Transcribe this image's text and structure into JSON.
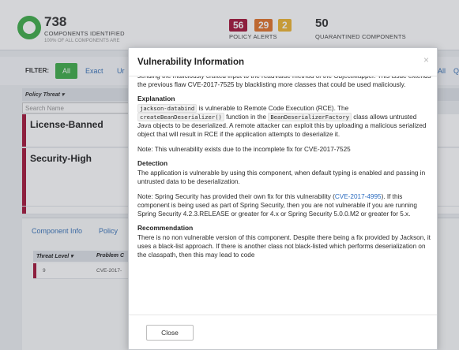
{
  "dashboard": {
    "components_count": "738",
    "components_label": "COMPONENTS IDENTIFIED",
    "components_sub": "100% OF ALL COMPONENTS ARE",
    "policy_alerts": {
      "red": "56",
      "orange": "29",
      "yellow": "2",
      "label": "POLICY ALERTS"
    },
    "quarantined_count": "50",
    "quarantined_label": "QUARANTINED COMPONENTS"
  },
  "filter": {
    "label": "FILTER:",
    "all": "All",
    "exact": "Exact",
    "partial": "Ur",
    "right_all": "All",
    "right_q": "Q"
  },
  "table": {
    "policy_threat_header": "Policy Threat ▾",
    "search_placeholder": "Search Name",
    "rows": [
      {
        "name": "License-Banned"
      },
      {
        "name": "Security-High"
      }
    ]
  },
  "lower": {
    "tabs": [
      "Component Info",
      "Policy"
    ],
    "threat_level_header": "Threat Level ▾",
    "problem_header": "Problem C",
    "row_level": "9",
    "row_problem": "CVE-2017-"
  },
  "modal": {
    "title": "Vulnerability Information",
    "close_x": "×",
    "intro_fragment": "sending the maliciously crafted input to the readValue method of the ObjectMapper. This issue extends the previous flaw CVE-2017-7525 by blacklisting more classes that could be used maliciously.",
    "explanation_heading": "Explanation",
    "explanation": {
      "code1": "jackson-databind",
      "text1": " is vulnerable to Remote Code Execution (RCE). The ",
      "code2": "createBeanDeserializer()",
      "text2": " function in the ",
      "code3": "BeanDeserializerFactory",
      "text3": " class allows untrusted Java objects to be deserialized. A remote attacker can exploit this by uploading a malicious serialized object that will result in RCE if the application attempts to deserialize it."
    },
    "note_incomplete": "Note: This vulnerability exists due to the incomplete fix for CVE-2017-7525",
    "detection_heading": "Detection",
    "detection": "The application is vulnerable by using this component, when default typing is enabled and passing in untrusted data to be deserialization.",
    "note_spring_pre": "Note: Spring Security has provided their own fix for this vulnerability (",
    "note_spring_link": "CVE-2017-4995",
    "note_spring_post": "). If this component is being used as part of Spring Security, then you are not vulnerable if you are running Spring Security 4.2.3.RELEASE or greater for 4.x or Spring Security 5.0.0.M2 or greater for 5.x.",
    "recommendation_heading": "Recommendation",
    "recommendation": "There is no non vulnerable version of this component. Despite there being a fix provided by Jackson, it uses a black-list approach. If there is another class not black-listed which performs deserialization on the classpath, then this may lead to code",
    "close_button": "Close"
  }
}
